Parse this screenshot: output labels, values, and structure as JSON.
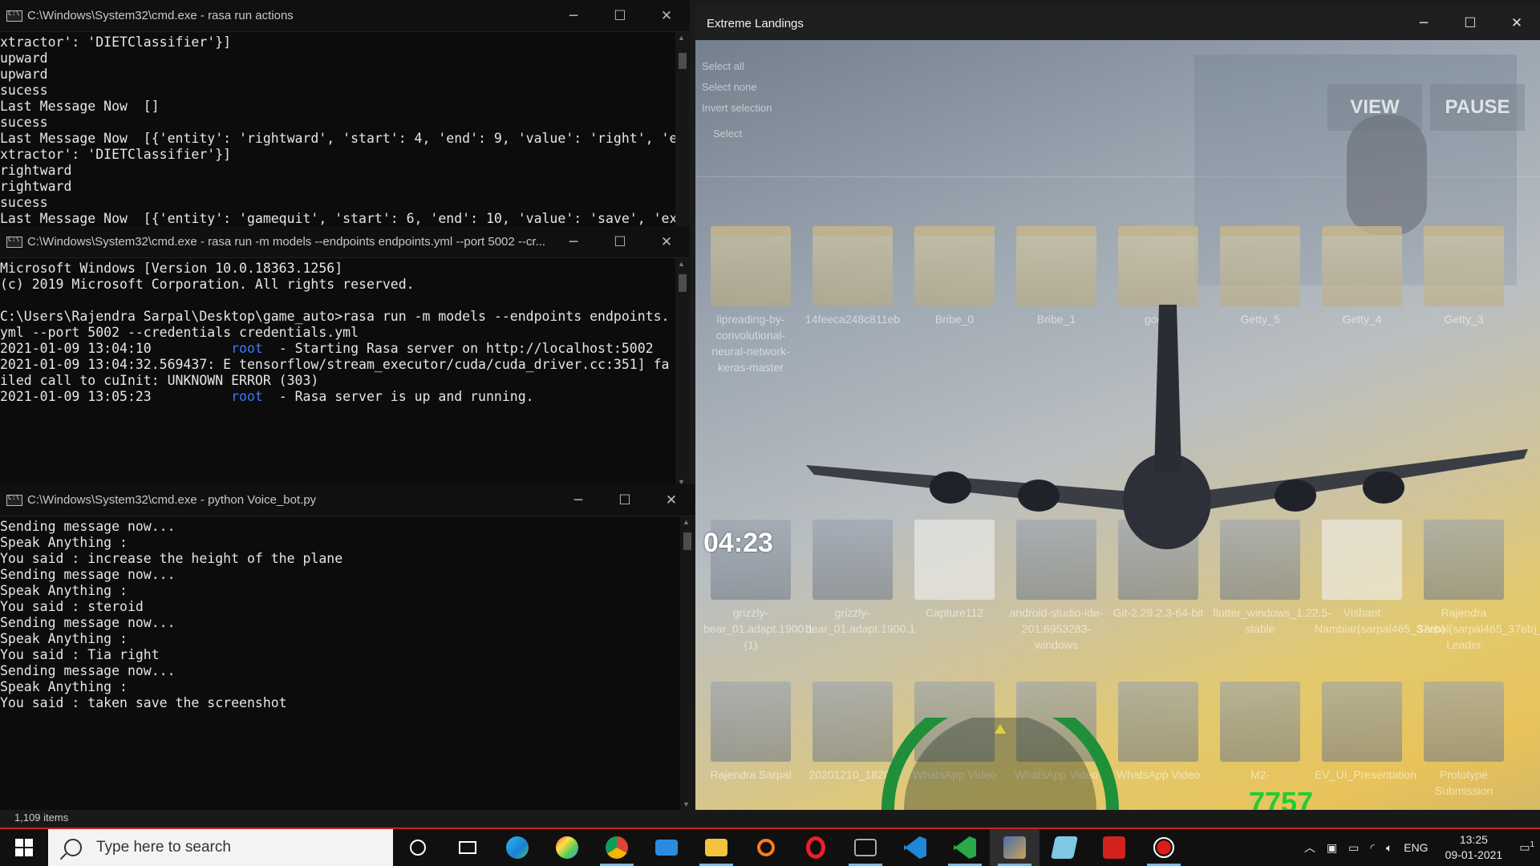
{
  "windows": {
    "cmd1": {
      "title": "C:\\Windows\\System32\\cmd.exe - rasa  run actions",
      "lines": [
        "xtractor': 'DIETClassifier'}]",
        "upward",
        "upward",
        "sucess",
        "Last Message Now  []",
        "sucess",
        "Last Message Now  [{'entity': 'rightward', 'start': 4, 'end': 9, 'value': 'right', 'e",
        "xtractor': 'DIETClassifier'}]",
        "rightward",
        "rightward",
        "sucess",
        "Last Message Now  [{'entity': 'gamequit', 'start': 6, 'end': 10, 'value': 'save', 'ex"
      ]
    },
    "cmd2": {
      "title": "C:\\Windows\\System32\\cmd.exe - rasa  run -m models --endpoints endpoints.yml --port 5002 --cr...",
      "lines": [
        "Microsoft Windows [Version 10.0.18363.1256]",
        "(c) 2019 Microsoft Corporation. All rights reserved.",
        "",
        "C:\\Users\\Rajendra Sarpal\\Desktop\\game_auto>rasa run -m models --endpoints endpoints.",
        "yml --port 5002 --credentials credentials.yml"
      ],
      "log": [
        {
          "prefix": "2021-01-09 13:04:10",
          "tag": "root",
          "msg": "- Starting Rasa server on http://localhost:5002"
        },
        {
          "prefix": "2021-01-09 13:04:32.569437: E tensorflow/stream_executor/cuda/cuda_driver.cc:351] fa",
          "tag": "",
          "msg": ""
        },
        {
          "prefix": "iled call to cuInit: UNKNOWN ERROR (303)",
          "tag": "",
          "msg": ""
        },
        {
          "prefix": "2021-01-09 13:05:23",
          "tag": "root",
          "msg": "- Rasa server is up and running."
        }
      ]
    },
    "cmd3": {
      "title": "C:\\Windows\\System32\\cmd.exe - python  Voice_bot.py",
      "lines": [
        "Sending message now...",
        "Speak Anything :",
        "You said : increase the height of the plane",
        "Sending message now...",
        "Speak Anything :",
        "You said : steroid",
        "Sending message now...",
        "Speak Anything :",
        "You said : Tia right",
        "Sending message now...",
        "Speak Anything :",
        "You said : taken save the screenshot"
      ]
    }
  },
  "game": {
    "title": "Extreme Landings",
    "view_label": "VIEW",
    "pause_label": "PAUSE",
    "timer": "04:23",
    "score": "7757",
    "context_menu": [
      "Select all",
      "Select none",
      "Invert selection",
      "Select"
    ],
    "desktop_row1": [
      "lipreading-by-convolutional-neural-network-keras-master",
      "14feeca248c811eb",
      "Bribe_0",
      "Bribe_1",
      "googl",
      "Getty_5",
      "Getty_4",
      "Getty_3"
    ],
    "desktop_row2": [
      "grizzly-bear_01.adapt.1900.1 (1)",
      "grizzly-bear_01.adapt.1900.1",
      "Capture112",
      "android-studio-ide-201.6953283-windows",
      "Git-2.29.2.3-64-bit",
      "flutter_windows_1.22.5-stable",
      "Vishant Nambiar(sarpal465_37eb)",
      "Rajendra Sarpal(sarpal465_37eb)_Team Leader"
    ],
    "desktop_row3": [
      "Rajendra Sarpal",
      "20201210_18200",
      "WhatsApp Video",
      "WhatsApp Video",
      "WhatsApp Video",
      "M2-",
      "EV_UI_Presentation",
      "Prototype Submission"
    ]
  },
  "statusbar": {
    "items": "1,109 items"
  },
  "taskbar": {
    "search_placeholder": "Type here to search",
    "language": "ENG",
    "time": "13:25",
    "date": "09-01-2021",
    "notification_count": "1"
  }
}
